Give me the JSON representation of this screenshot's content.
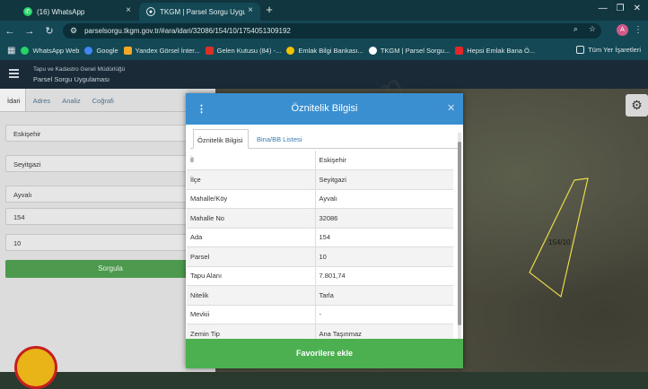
{
  "browser": {
    "tabs": [
      {
        "label": "(16) WhatsApp",
        "icon": "whatsapp-icon",
        "active": false
      },
      {
        "label": "TKGM | Parsel Sorgu Uygulaması",
        "icon": "location-pin-icon",
        "active": true
      }
    ],
    "url": "parselsorgu.tkgm.gov.tr/#ara/idari/32086/154/10/1754051309192",
    "profile_initial": "A",
    "bookmarks": [
      {
        "label": "WhatsApp Web",
        "color": "#25d366"
      },
      {
        "label": "Google",
        "color": "#4285f4"
      },
      {
        "label": "Yandex Görsel İnter...",
        "color": "#f5a623"
      },
      {
        "label": "Gelen Kutusu (84) -...",
        "color": "#d93025"
      },
      {
        "label": "Emlak Bilgi Bankası...",
        "color": "#f2c200"
      },
      {
        "label": "TKGM | Parsel Sorgu...",
        "color": "#ffffff"
      },
      {
        "label": "Hepsi Emlak Bana Ö...",
        "color": "#e3262b"
      }
    ],
    "all_bookmarks_label": "Tüm Yer İşaretleri"
  },
  "app": {
    "header_line1": "Tapu ve Kadastro Genel Müdürlüğü",
    "header_line2": "Parsel Sorgu Uygulaması"
  },
  "sidebar": {
    "tabs": [
      "İdari",
      "Adres",
      "Analiz",
      "Coğrafi"
    ],
    "fields": {
      "il": "Eskişehir",
      "ilce": "Seyitgazi",
      "mahalle": "Ayvalı",
      "ada": "154",
      "parsel": "10"
    },
    "query_button": "Sorgula"
  },
  "map": {
    "parcel_label": "154/10",
    "watermark": "emlakjet.com"
  },
  "modal": {
    "title": "Öznitelik Bilgisi",
    "tabs": [
      "Öznitelik Bilgisi",
      "Bina/BB Listesi"
    ],
    "rows": [
      {
        "key": "İl",
        "value": "Eskişehir"
      },
      {
        "key": "İlçe",
        "value": "Seyitgazi"
      },
      {
        "key": "Mahalle/Köy",
        "value": "Ayvalı"
      },
      {
        "key": "Mahalle No",
        "value": "32086"
      },
      {
        "key": "Ada",
        "value": "154"
      },
      {
        "key": "Parsel",
        "value": "10"
      },
      {
        "key": "Tapu Alanı",
        "value": "7.801,74"
      },
      {
        "key": "Nitelik",
        "value": "Tarla"
      },
      {
        "key": "Mevkii",
        "value": "-"
      },
      {
        "key": "Zemin Tip",
        "value": "Ana Taşınmaz"
      }
    ],
    "favorite_button": "Favorilere ekle"
  }
}
